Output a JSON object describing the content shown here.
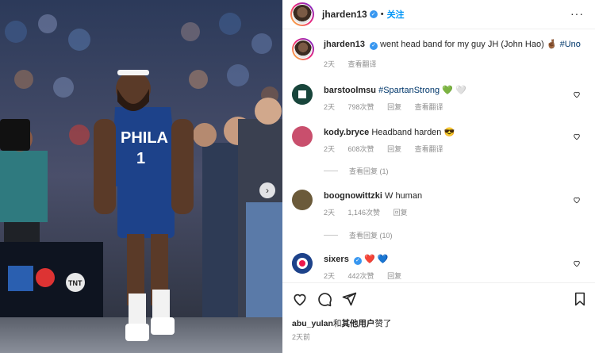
{
  "header": {
    "username": "jharden13",
    "verified": true,
    "separator": "•",
    "follow_label": "关注",
    "more_label": "···"
  },
  "caption": {
    "username": "jharden13",
    "text": "went head band for my guy JH (John Hao)",
    "emoji": "🤞🏾",
    "hashtag": "#Uno",
    "time": "2天",
    "translate": "查看翻译"
  },
  "comments": [
    {
      "username": "barstoolmsu",
      "text": "",
      "hashtag": "#SpartanStrong",
      "emojis": "💚 🤍",
      "time": "2天",
      "likes": "798次赞",
      "reply": "回复",
      "translate": "查看翻译",
      "avatar_color": "#18453b"
    },
    {
      "username": "kody.bryce",
      "text": "Headband harden",
      "hashtag": "",
      "emojis": "😎",
      "time": "2天",
      "likes": "608次赞",
      "reply": "回复",
      "translate": "查看翻译",
      "avatar_color": "#c94f6d",
      "view_replies": "查看回复 (1)"
    },
    {
      "username": "boognowittzki",
      "text": "W human",
      "hashtag": "",
      "emojis": "",
      "time": "2天",
      "likes": "1,146次赞",
      "reply": "回复",
      "translate": "",
      "avatar_color": "#6b5a3a",
      "view_replies": "查看回复 (10)"
    },
    {
      "username": "sixers",
      "text": "",
      "hashtag": "",
      "emojis": "❤️ 💙",
      "time": "2天",
      "likes": "442次赞",
      "reply": "回复",
      "translate": "",
      "avatar_color": "#1d428a",
      "verified": true
    }
  ],
  "footer": {
    "liked_by_user": "abu_yulan",
    "liked_by_mid": "和",
    "liked_by_others": "其他用户",
    "liked_by_suffix": "赞了",
    "time": "2天前"
  },
  "photo": {
    "jersey_team": "PHILA",
    "jersey_number": "1",
    "logo_text": "TNT"
  },
  "colors": {
    "link": "#0095f6",
    "hashtag": "#00376b",
    "muted": "#8e8e8e",
    "jersey": "#1d428a"
  }
}
